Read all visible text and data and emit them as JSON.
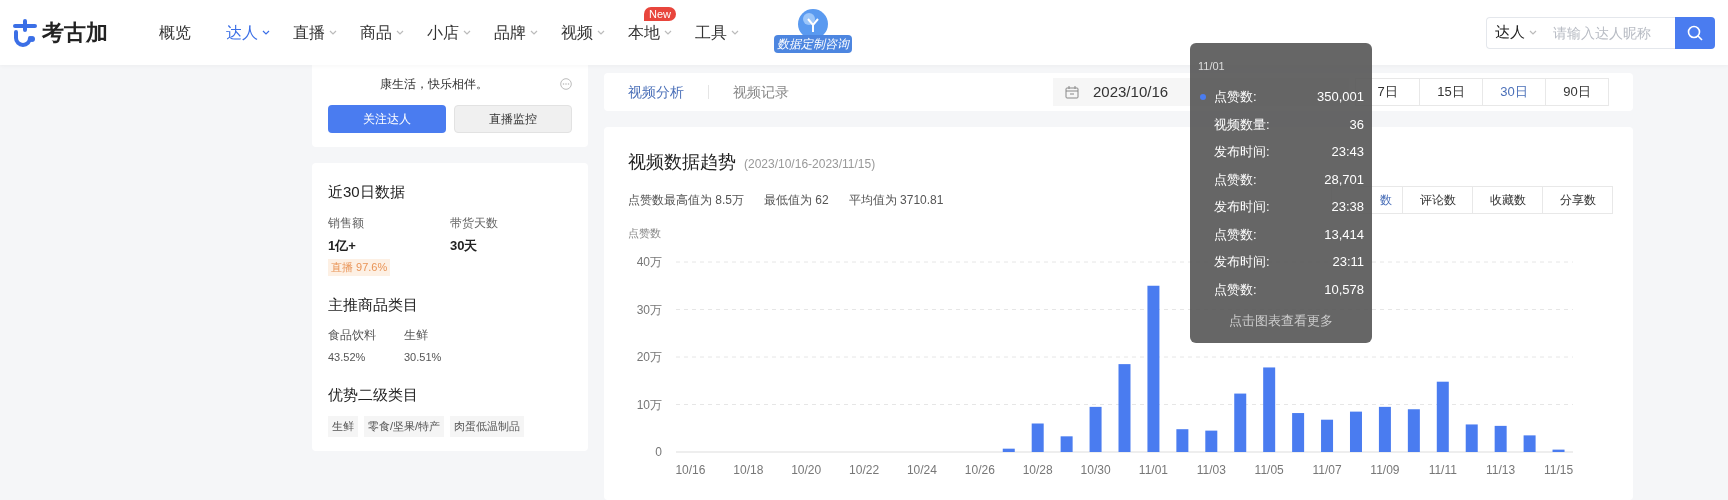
{
  "logo": {
    "text": "考古加"
  },
  "nav": [
    {
      "label": "概览",
      "selected": false,
      "dropdown": false
    },
    {
      "label": "达人",
      "selected": true,
      "dropdown": true
    },
    {
      "label": "直播",
      "selected": false,
      "dropdown": true
    },
    {
      "label": "商品",
      "selected": false,
      "dropdown": true
    },
    {
      "label": "小店",
      "selected": false,
      "dropdown": true
    },
    {
      "label": "品牌",
      "selected": false,
      "dropdown": true
    },
    {
      "label": "视频",
      "selected": false,
      "dropdown": true
    },
    {
      "label": "本地",
      "selected": false,
      "dropdown": true,
      "badge": "New"
    },
    {
      "label": "工具",
      "selected": false,
      "dropdown": true
    }
  ],
  "promo": {
    "text": "数据定制咨询"
  },
  "search": {
    "scope": "达人",
    "placeholder": "请输入达人昵称"
  },
  "profile": {
    "bio": "康生活，快乐相伴。",
    "buttons": [
      {
        "label": "关注达人",
        "kind": "primary"
      },
      {
        "label": "直播监控",
        "kind": "secondary"
      }
    ]
  },
  "stats": {
    "title": "近30日数据",
    "metrics": [
      {
        "label": "销售额",
        "value": "1亿+",
        "tag": "直播 97.6%"
      },
      {
        "label": "带货天数",
        "value": "30天"
      }
    ],
    "category_title": "主推商品类目",
    "categories": [
      {
        "name": "食品饮料",
        "share": "43.52%"
      },
      {
        "name": "生鲜",
        "share": "30.51%"
      }
    ],
    "sub_title": "优势二级类目",
    "sub_tags": [
      "生鲜",
      "零食/坚果/特产",
      "肉蛋低温制品"
    ]
  },
  "tabs": [
    {
      "label": "视频分析",
      "selected": true
    },
    {
      "label": "视频记录",
      "selected": false
    }
  ],
  "date_range": {
    "start": "2023/10/16"
  },
  "periods": [
    {
      "label": "7日",
      "selected": false
    },
    {
      "label": "15日",
      "selected": false
    },
    {
      "label": "30日",
      "selected": true
    },
    {
      "label": "90日",
      "selected": false
    }
  ],
  "trend": {
    "title": "视频数据趋势",
    "range": "(2023/10/16-2023/11/15)",
    "summary": [
      "点赞数最高值为 8.5万",
      "最低值为 62",
      "平均值为 3710.81"
    ],
    "metric_tabs": [
      {
        "label": "数",
        "selected": true
      },
      {
        "label": "评论数",
        "selected": false
      },
      {
        "label": "收藏数",
        "selected": false
      },
      {
        "label": "分享数",
        "selected": false
      }
    ],
    "chart_data": {
      "type": "bar",
      "ylabel": "点赞数",
      "categories": [
        "10/16",
        null,
        "10/18",
        null,
        "10/20",
        null,
        "10/22",
        null,
        "10/24",
        null,
        "10/26",
        null,
        "10/28",
        null,
        "10/30",
        null,
        "11/01",
        null,
        "11/03",
        null,
        "11/05",
        null,
        "11/07",
        null,
        "11/09",
        null,
        "11/11",
        null,
        "11/13",
        null,
        "11/15"
      ],
      "grid": true,
      "series": [
        {
          "color": "#4a7cf0",
          "values": [
            0,
            0,
            0,
            0,
            0,
            0,
            0,
            0,
            0,
            0,
            0,
            0.7,
            6,
            3.3,
            9.5,
            18.5,
            35,
            4.8,
            4.5,
            12.3,
            17.8,
            8.2,
            6.8,
            8.5,
            9.5,
            9,
            14.8,
            5.8,
            5.5,
            3.5,
            0.5
          ]
        }
      ],
      "ylim": [
        0,
        40
      ],
      "yticks": [
        {
          "value": 0,
          "label": "0"
        },
        {
          "value": 10,
          "label": "10万"
        },
        {
          "value": 20,
          "label": "20万"
        },
        {
          "value": 30,
          "label": "30万"
        },
        {
          "value": 40,
          "label": "40万"
        }
      ]
    },
    "tooltip": {
      "date": "11/01",
      "rows": [
        {
          "label": "点赞数:",
          "value": "350,001",
          "color": "#4a7cf0"
        },
        {
          "label": "视频数量:",
          "value": "36"
        },
        {
          "label": "发布时间:",
          "value": "23:43"
        },
        {
          "label": "点赞数:",
          "value": "28,701"
        },
        {
          "label": "发布时间:",
          "value": "23:38"
        },
        {
          "label": "点赞数:",
          "value": "13,414"
        },
        {
          "label": "发布时间:",
          "value": "23:11"
        },
        {
          "label": "点赞数:",
          "value": "10,578"
        }
      ],
      "footer": "点击图表查看更多"
    }
  }
}
